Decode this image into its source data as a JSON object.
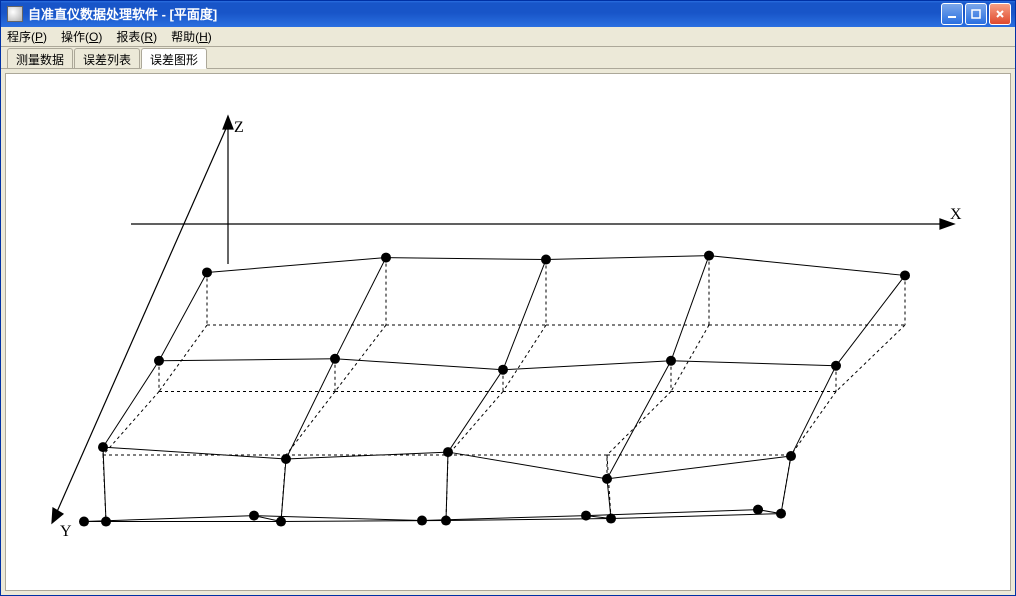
{
  "window": {
    "title": "自准直仪数据处理软件  -  [平面度]"
  },
  "menu": {
    "program": "程序",
    "program_key": "P",
    "operate": "操作",
    "operate_key": "O",
    "report": "报表",
    "report_key": "R",
    "help": "帮助",
    "help_key": "H"
  },
  "tabs": {
    "data": "测量数据",
    "errlist": "误差列表",
    "errgraph": "误差图形"
  },
  "axes": {
    "x": "X",
    "y": "Y",
    "z": "Z"
  },
  "chart_data": {
    "type": "surface3d_wireframe",
    "axes": {
      "x": "X",
      "y": "Y",
      "z": "Z"
    },
    "description": "5×5 measured flatness deviation grid plotted as a 3D wireframe above a dashed ground-plane grid. Axes: X right, Y toward viewer/down-left, Z up. Values are visual deviation heights read off the plot (arbitrary units).",
    "grid": {
      "nx": 5,
      "ny": 5
    },
    "iso_points_pixels_upper": [
      [
        [
          201,
          200
        ],
        [
          380,
          185
        ],
        [
          540,
          187
        ],
        [
          703,
          183
        ],
        [
          899,
          203
        ]
      ],
      [
        [
          153,
          289
        ],
        [
          329,
          287
        ],
        [
          497,
          298
        ],
        [
          665,
          289
        ],
        [
          830,
          294
        ]
      ],
      [
        [
          97,
          376
        ],
        [
          280,
          388
        ],
        [
          442,
          381
        ],
        [
          601,
          408
        ],
        [
          785,
          385
        ]
      ],
      [
        [
          100,
          451
        ],
        [
          275,
          451
        ],
        [
          440,
          450
        ],
        [
          605,
          448
        ],
        [
          775,
          443
        ]
      ],
      [
        [
          78,
          451
        ],
        [
          248,
          445
        ],
        [
          416,
          450
        ],
        [
          580,
          445
        ],
        [
          752,
          439
        ]
      ]
    ],
    "iso_points_pixels_lower": [
      [
        [
          201,
          253
        ],
        [
          380,
          253
        ],
        [
          540,
          253
        ],
        [
          703,
          253
        ],
        [
          899,
          253
        ]
      ],
      [
        [
          153,
          320
        ],
        [
          329,
          320
        ],
        [
          497,
          320
        ],
        [
          665,
          320
        ],
        [
          830,
          320
        ]
      ],
      [
        [
          97,
          384
        ],
        [
          280,
          384
        ],
        [
          442,
          384
        ],
        [
          601,
          384
        ],
        [
          785,
          384
        ]
      ],
      [
        [
          100,
          451
        ],
        [
          275,
          451
        ],
        [
          440,
          450
        ],
        [
          605,
          448
        ],
        [
          775,
          443
        ]
      ],
      [
        [
          78,
          451
        ],
        [
          248,
          445
        ],
        [
          416,
          450
        ],
        [
          580,
          445
        ],
        [
          752,
          439
        ]
      ]
    ],
    "z_values_estimate": [
      [
        53,
        68,
        66,
        70,
        50
      ],
      [
        31,
        33,
        22,
        31,
        26
      ],
      [
        8,
        -4,
        3,
        -24,
        -1
      ],
      [
        0,
        0,
        1,
        3,
        8
      ],
      [
        0,
        6,
        1,
        6,
        13
      ]
    ]
  }
}
